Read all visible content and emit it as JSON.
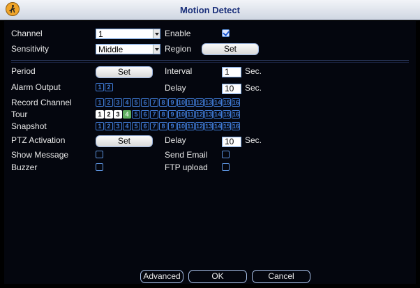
{
  "title": "Motion Detect",
  "channel": {
    "label": "Channel",
    "value": "1"
  },
  "enable": {
    "label": "Enable",
    "checked": true
  },
  "sensitivity": {
    "label": "Sensitivity",
    "value": "Middle"
  },
  "region": {
    "label": "Region",
    "button": "Set"
  },
  "period": {
    "label": "Period",
    "button": "Set"
  },
  "interval": {
    "label": "Interval",
    "value": "1",
    "unit": "Sec."
  },
  "alarm_output": {
    "label": "Alarm Output",
    "channels": [
      "1",
      "2"
    ]
  },
  "delay": {
    "label": "Delay",
    "value": "10",
    "unit": "Sec."
  },
  "record_channel": {
    "label": "Record Channel",
    "channels": [
      "1",
      "2",
      "3",
      "4",
      "5",
      "6",
      "7",
      "8",
      "9",
      "10",
      "11",
      "12",
      "13",
      "14",
      "15",
      "16"
    ],
    "selected": []
  },
  "tour": {
    "label": "Tour",
    "channels": [
      "1",
      "2",
      "3",
      "4",
      "5",
      "6",
      "7",
      "8",
      "9",
      "10",
      "11",
      "12",
      "13",
      "14",
      "15",
      "16"
    ],
    "selected": [
      "1",
      "2",
      "3"
    ],
    "highlighted": [
      "4"
    ]
  },
  "snapshot": {
    "label": "Snapshot",
    "channels": [
      "1",
      "2",
      "3",
      "4",
      "5",
      "6",
      "7",
      "8",
      "9",
      "10",
      "11",
      "12",
      "13",
      "14",
      "15",
      "16"
    ],
    "selected": []
  },
  "ptz_activation": {
    "label": "PTZ Activation",
    "button": "Set"
  },
  "ptz_delay": {
    "label": "Delay",
    "value": "10",
    "unit": "Sec."
  },
  "show_message": {
    "label": "Show Message",
    "checked": false
  },
  "send_email": {
    "label": "Send Email",
    "checked": false
  },
  "buzzer": {
    "label": "Buzzer",
    "checked": false
  },
  "ftp_upload": {
    "label": "FTP upload",
    "checked": false
  },
  "buttons": {
    "advanced": "Advanced",
    "ok": "OK",
    "cancel": "Cancel"
  },
  "icons": {
    "title": "running-figure-icon"
  }
}
